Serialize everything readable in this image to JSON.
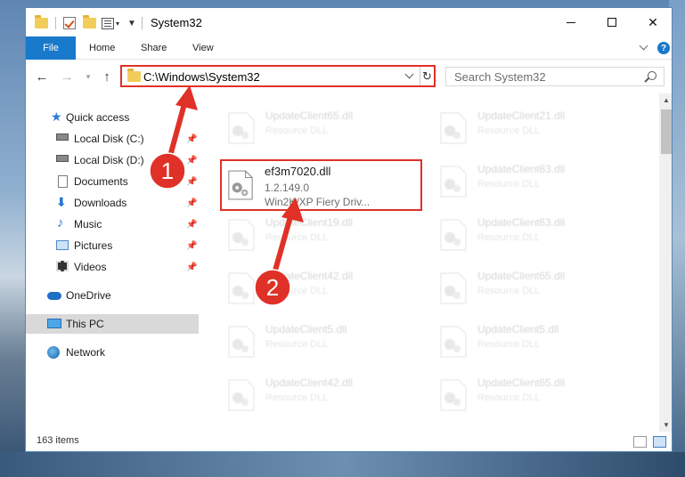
{
  "window": {
    "title": "System32",
    "buttons": {
      "minimize": "minimize",
      "maximize": "maximize",
      "close": "✕"
    }
  },
  "ribbon": {
    "tabs": [
      "File",
      "Home",
      "Share",
      "View"
    ]
  },
  "navigation": {
    "address": "C:\\Windows\\System32",
    "search_placeholder": "Search System32"
  },
  "sidebar": {
    "items": [
      {
        "label": "Quick access",
        "icon": "star-icon",
        "pinned": false
      },
      {
        "label": "Local Disk (C:)",
        "icon": "drive-icon",
        "pinned": true
      },
      {
        "label": "Local Disk (D:)",
        "icon": "drive-icon",
        "pinned": true
      },
      {
        "label": "Documents",
        "icon": "documents-icon",
        "pinned": true
      },
      {
        "label": "Downloads",
        "icon": "downloads-icon",
        "pinned": true
      },
      {
        "label": "Music",
        "icon": "music-icon",
        "pinned": true
      },
      {
        "label": "Pictures",
        "icon": "pictures-icon",
        "pinned": true
      },
      {
        "label": "Videos",
        "icon": "videos-icon",
        "pinned": true
      },
      {
        "label": "OneDrive",
        "icon": "onedrive-icon",
        "pinned": false
      },
      {
        "label": "This PC",
        "icon": "this-pc-icon",
        "pinned": false,
        "selected": true
      },
      {
        "label": "Network",
        "icon": "network-icon",
        "pinned": false
      }
    ]
  },
  "files": {
    "left_column": [
      {
        "name": "UpdateClient65.dll",
        "type": "Resource DLL"
      },
      {
        "name": "UpdateClient19.dll",
        "type": "Resource DLL"
      },
      {
        "name": "UpdateClient42.dll",
        "type": "Resource DLL"
      },
      {
        "name": "UpdateClient5.dll",
        "type": "Resource DLL"
      },
      {
        "name": "UpdateClient42.dll",
        "type": "Resource DLL"
      }
    ],
    "right_column": [
      {
        "name": "UpdateClient21.dll",
        "type": "Resource DLL"
      },
      {
        "name": "UpdateClient63.dll",
        "type": "Resource DLL"
      },
      {
        "name": "UpdateClient63.dll",
        "type": "Resource DLL"
      },
      {
        "name": "UpdateClient65.dll",
        "type": "Resource DLL"
      },
      {
        "name": "UpdateClient5.dll",
        "type": "Resource DLL"
      },
      {
        "name": "UpdateClient65.dll",
        "type": "Resource DLL"
      }
    ],
    "highlighted": {
      "name": "ef3m7020.dll",
      "version": "1.2.149.0",
      "description": "Win2K/XP Fiery Driv..."
    }
  },
  "status": {
    "item_count": "163 items"
  },
  "annotations": {
    "step1": "1",
    "step2": "2",
    "color": "#e03128"
  }
}
